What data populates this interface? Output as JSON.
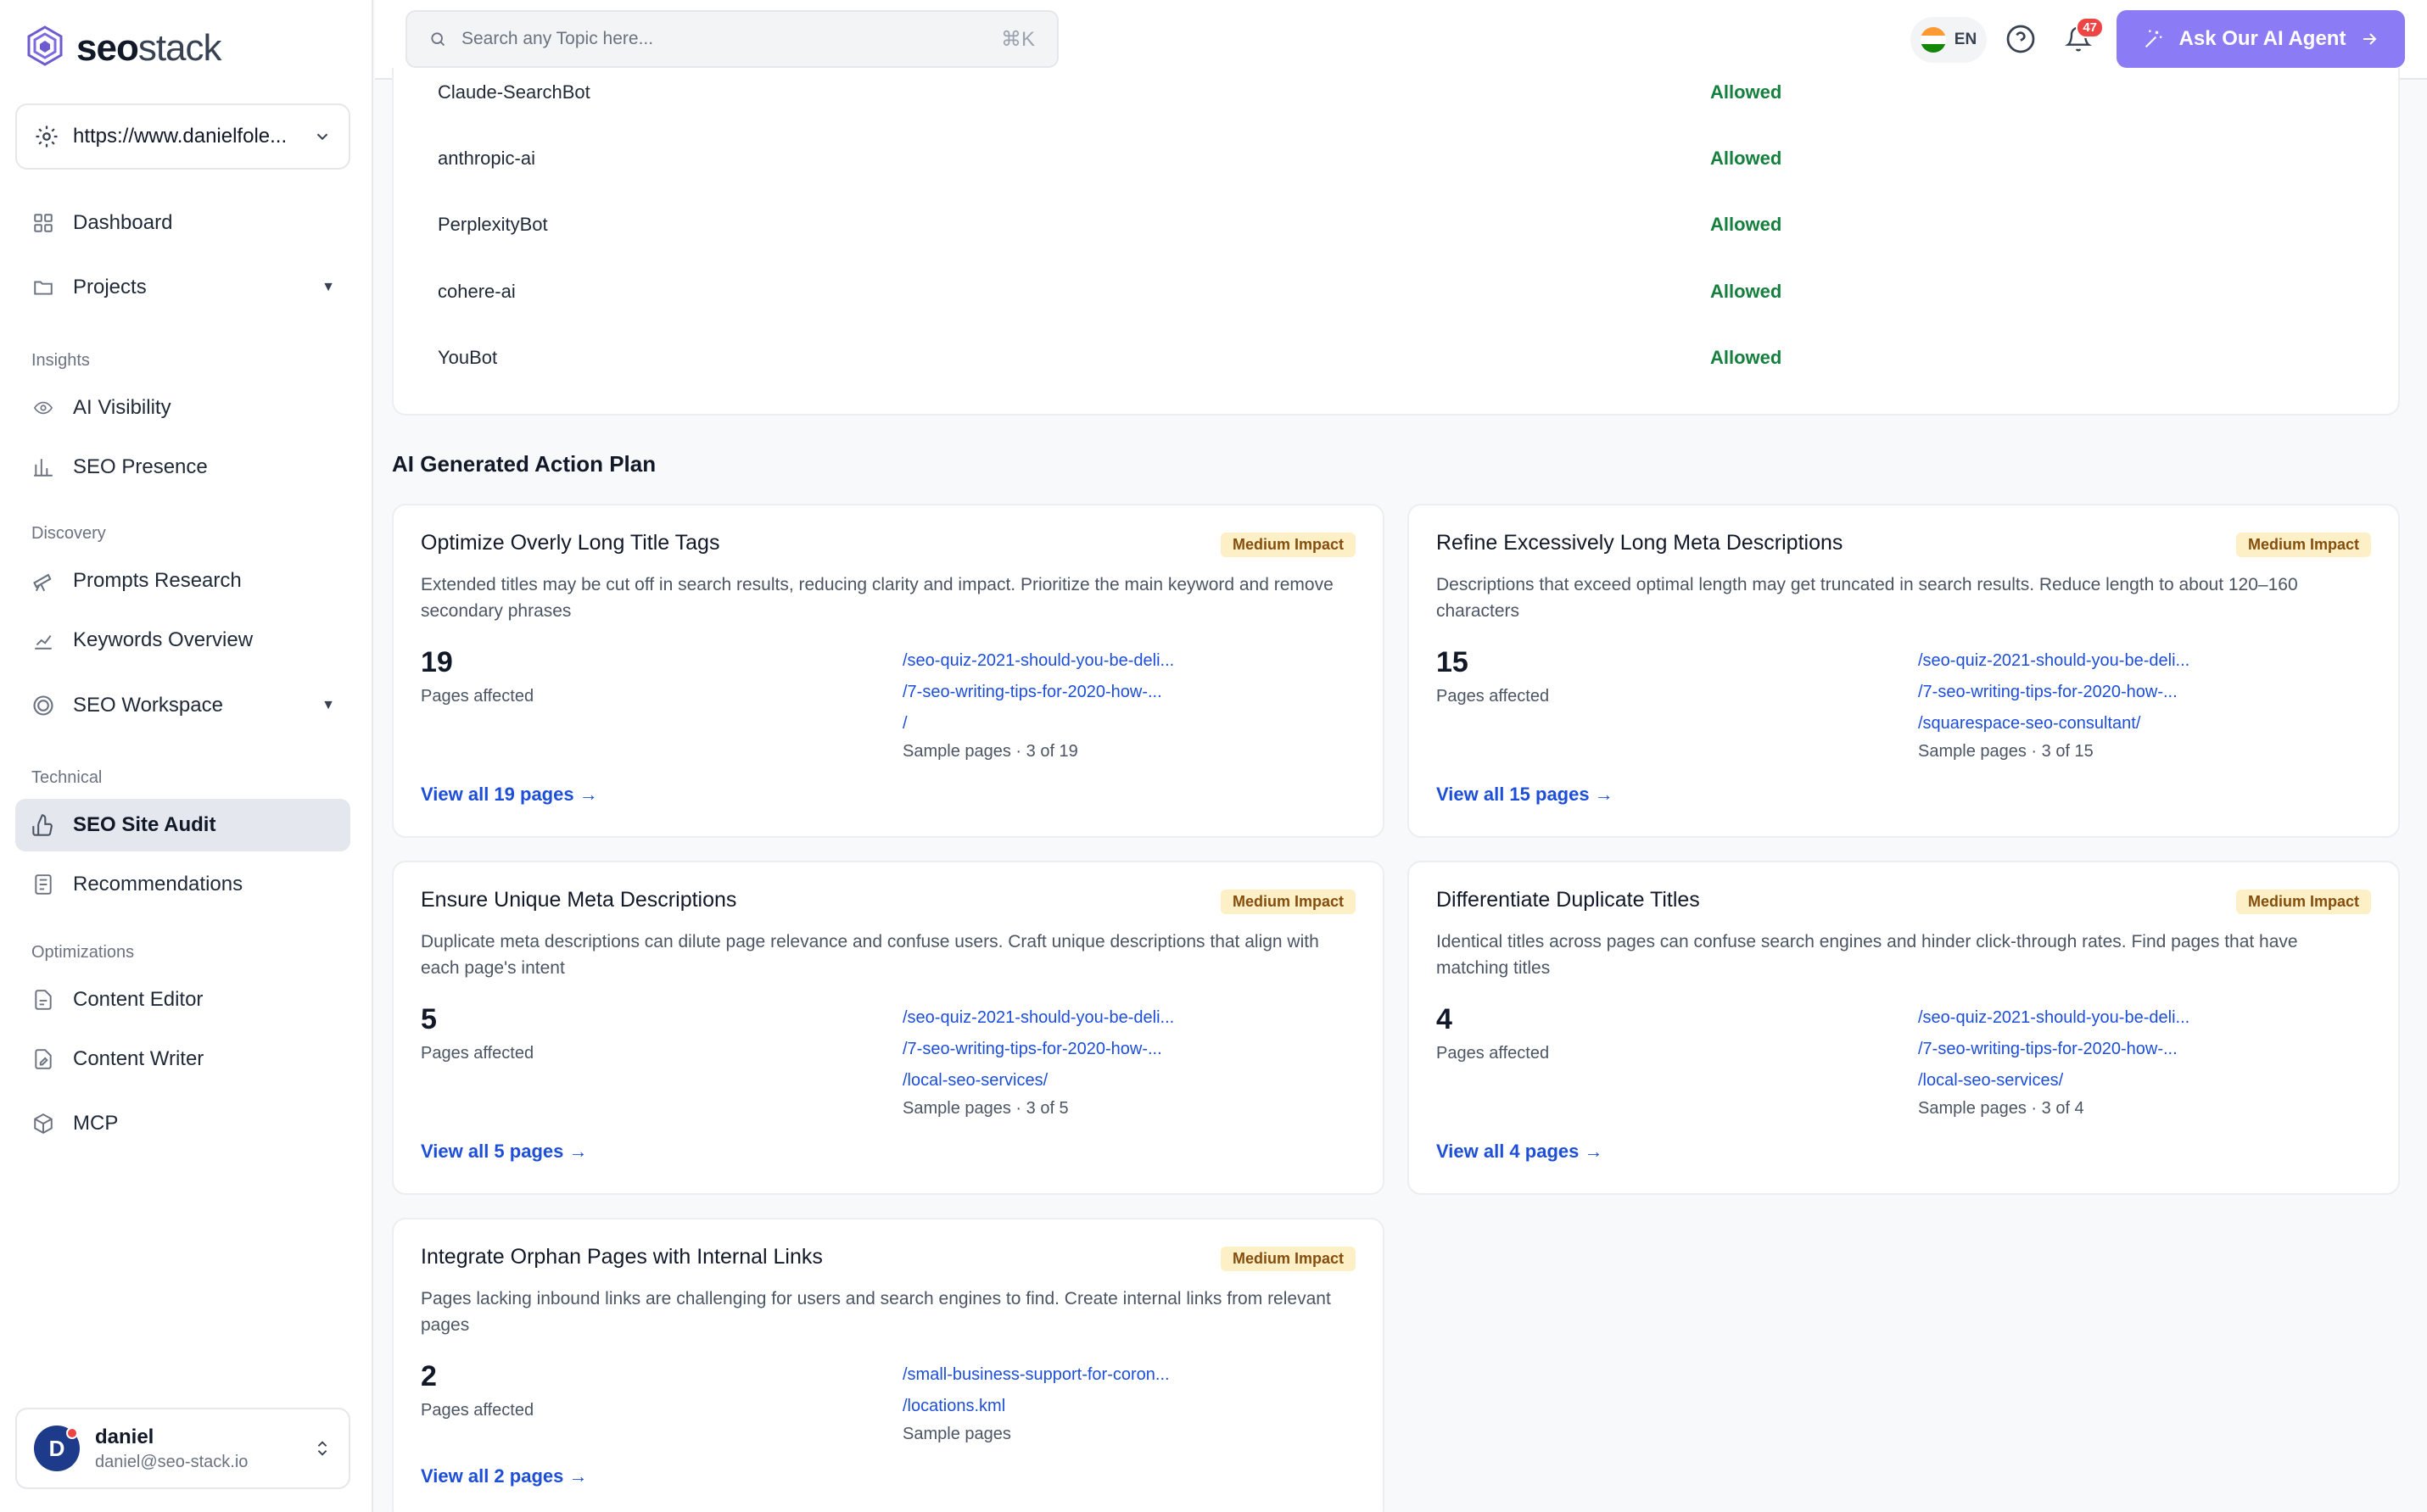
{
  "brand": {
    "name_bold": "seo",
    "name_rest": "stack"
  },
  "site_selector": {
    "value": "https://www.danielfole..."
  },
  "nav": {
    "dashboard": "Dashboard",
    "projects": "Projects",
    "insights_label": "Insights",
    "ai_visibility": "AI Visibility",
    "seo_presence": "SEO Presence",
    "discovery_label": "Discovery",
    "prompts_research": "Prompts Research",
    "keywords_overview": "Keywords Overview",
    "seo_workspace": "SEO Workspace",
    "technical_label": "Technical",
    "seo_site_audit": "SEO Site Audit",
    "recommendations": "Recommendations",
    "optimizations_label": "Optimizations",
    "content_editor": "Content Editor",
    "content_writer": "Content Writer",
    "mcp": "MCP"
  },
  "user": {
    "initial": "D",
    "name": "daniel",
    "email": "daniel@seo-stack.io"
  },
  "header": {
    "search_placeholder": "Search any Topic here...",
    "search_shortcut": "⌘K",
    "language": "EN",
    "notification_count": "47",
    "ai_button": "Ask Our AI Agent"
  },
  "bots": [
    {
      "name": "Claude-SearchBot",
      "status": "Allowed"
    },
    {
      "name": "anthropic-ai",
      "status": "Allowed"
    },
    {
      "name": "PerplexityBot",
      "status": "Allowed"
    },
    {
      "name": "cohere-ai",
      "status": "Allowed"
    },
    {
      "name": "YouBot",
      "status": "Allowed"
    }
  ],
  "action_plan": {
    "title": "AI Generated Action Plan",
    "pages_affected_label": "Pages affected",
    "cards": [
      {
        "title": "Optimize Overly Long Title Tags",
        "impact": "Medium Impact",
        "desc": "Extended titles may be cut off in search results, reducing clarity and impact. Prioritize the main keyword and remove secondary phrases",
        "count": "19",
        "pages": [
          "/seo-quiz-2021-should-you-be-deli...",
          "/7-seo-writing-tips-for-2020-how-...",
          "/"
        ],
        "sample": "Sample pages · 3 of 19",
        "view_all": "View all 19 pages →"
      },
      {
        "title": "Refine Excessively Long Meta Descriptions",
        "impact": "Medium Impact",
        "desc": "Descriptions that exceed optimal length may get truncated in search results. Reduce length to about 120–160 characters",
        "count": "15",
        "pages": [
          "/seo-quiz-2021-should-you-be-deli...",
          "/7-seo-writing-tips-for-2020-how-...",
          "/squarespace-seo-consultant/"
        ],
        "sample": "Sample pages · 3 of 15",
        "view_all": "View all 15 pages →"
      },
      {
        "title": "Ensure Unique Meta Descriptions",
        "impact": "Medium Impact",
        "desc": "Duplicate meta descriptions can dilute page relevance and confuse users. Craft unique descriptions that align with each page's intent",
        "count": "5",
        "pages": [
          "/seo-quiz-2021-should-you-be-deli...",
          "/7-seo-writing-tips-for-2020-how-...",
          "/local-seo-services/"
        ],
        "sample": "Sample pages · 3 of 5",
        "view_all": "View all 5 pages →"
      },
      {
        "title": "Differentiate Duplicate Titles",
        "impact": "Medium Impact",
        "desc": "Identical titles across pages can confuse search engines and hinder click-through rates. Find pages that have matching titles",
        "count": "4",
        "pages": [
          "/seo-quiz-2021-should-you-be-deli...",
          "/7-seo-writing-tips-for-2020-how-...",
          "/local-seo-services/"
        ],
        "sample": "Sample pages · 3 of 4",
        "view_all": "View all 4 pages →"
      },
      {
        "title": "Integrate Orphan Pages with Internal Links",
        "impact": "Medium Impact",
        "desc": "Pages lacking inbound links are challenging for users and search engines to find. Create internal links from relevant pages",
        "count": "2",
        "pages": [
          "/small-business-support-for-coron...",
          "/locations.kml"
        ],
        "sample": "Sample pages",
        "view_all": "View all 2 pages →"
      }
    ]
  },
  "colors": {
    "accent": "#8b7cf6",
    "link": "#1d4ed8",
    "allowed": "#15803d",
    "impact_bg": "#fdf0c6"
  }
}
